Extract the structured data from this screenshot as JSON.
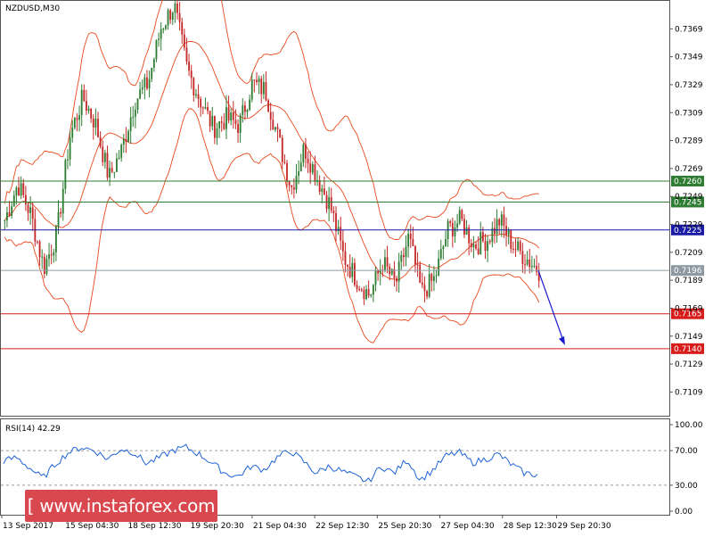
{
  "chart_data": {
    "type": "candlestick",
    "title": "NZDUSD,M30",
    "price_axis": {
      "ylim": [
        0.7092,
        0.7389
      ],
      "ticks": [
        "0.7369",
        "0.7349",
        "0.7329",
        "0.7309",
        "0.7289",
        "0.7269",
        "0.7249",
        "0.7229",
        "0.7209",
        "0.7189",
        "0.7169",
        "0.7149",
        "0.7129",
        "0.7109"
      ]
    },
    "x_labels": [
      "13 Sep 2017",
      "15 Sep 04:30",
      "18 Sep 12:30",
      "19 Sep 20:30",
      "21 Sep 04:30",
      "22 Sep 12:30",
      "25 Sep 20:30",
      "27 Sep 04:30",
      "28 Sep 12:30",
      "29 Sep 20:30"
    ],
    "levels": [
      {
        "label": "0.7260",
        "value": 0.726,
        "color": "#2e7d32"
      },
      {
        "label": "0.7245",
        "value": 0.7245,
        "color": "#2e7d32"
      },
      {
        "label": "0.7225",
        "value": 0.7225,
        "color": "#1a1aa6"
      },
      {
        "label": "0.7196",
        "value": 0.7196,
        "color": "#8e9aa3"
      },
      {
        "label": "0.7165",
        "value": 0.7165,
        "color": "#d81b1b"
      },
      {
        "label": "0.7140",
        "value": 0.714,
        "color": "#d81b1b"
      }
    ],
    "price_path": [
      0.7232,
      0.7258,
      0.7236,
      0.7198,
      0.7222,
      0.7292,
      0.732,
      0.73,
      0.7262,
      0.7283,
      0.7318,
      0.733,
      0.737,
      0.7386,
      0.734,
      0.7318,
      0.7298,
      0.7305,
      0.73,
      0.733,
      0.7325,
      0.729,
      0.7255,
      0.7284,
      0.7262,
      0.7242,
      0.7206,
      0.719,
      0.7178,
      0.7202,
      0.7186,
      0.722,
      0.718,
      0.719,
      0.7225,
      0.7232,
      0.7214,
      0.7218,
      0.7232,
      0.7214,
      0.7205,
      0.7196
    ],
    "forecast_arrow": {
      "from": 0.7196,
      "to": 0.714
    },
    "rsi": {
      "label": "RSI(14) 42.29",
      "ylim": [
        0,
        100
      ],
      "ticks": [
        "100.00",
        "70.00",
        "30.00",
        "0.00"
      ],
      "levels": [
        70,
        30
      ],
      "values": [
        58,
        62,
        50,
        38,
        55,
        68,
        74,
        70,
        60,
        72,
        68,
        55,
        62,
        70,
        74,
        66,
        56,
        44,
        40,
        52,
        48,
        62,
        70,
        58,
        44,
        52,
        46,
        40,
        34,
        52,
        44,
        60,
        36,
        48,
        64,
        68,
        56,
        60,
        66,
        54,
        44,
        42
      ]
    },
    "grid": false,
    "colors": {
      "bull": "#2e7d32",
      "bear": "#c62828",
      "bands": "#e8491d",
      "rsi": "#1e63d6"
    }
  },
  "watermark": "[  www.instaforex.com  ]"
}
